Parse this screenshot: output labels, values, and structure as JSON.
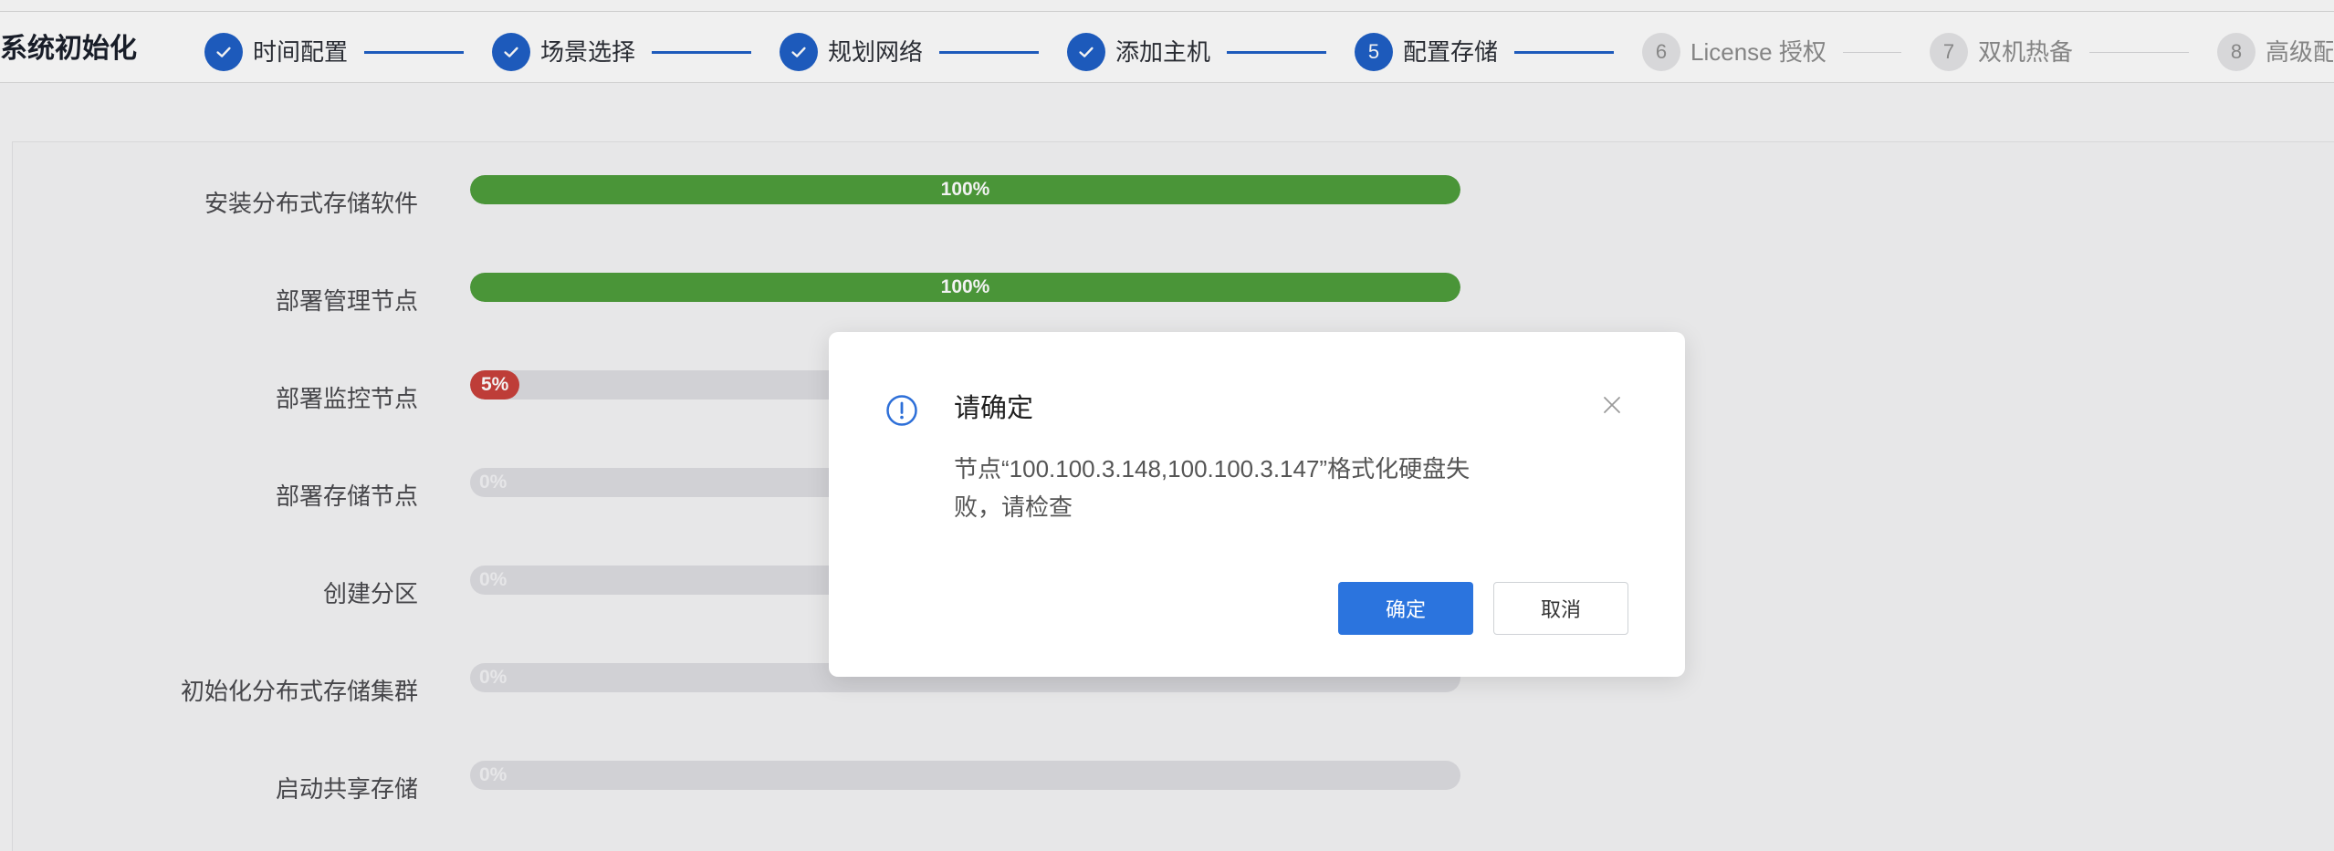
{
  "colors": {
    "primary": "#1f5fc6",
    "success": "#4f9d3c",
    "danger": "#c9413b",
    "track": "#dddde1",
    "pending_circle": "#e3e3e5"
  },
  "header": {
    "title": "系统初始化"
  },
  "steps": [
    {
      "label": "时间配置",
      "completed": true,
      "icon": "check-icon"
    },
    {
      "label": "场景选择",
      "completed": true,
      "icon": "check-icon"
    },
    {
      "label": "规划网络",
      "completed": true,
      "icon": "check-icon"
    },
    {
      "label": "添加主机",
      "completed": true,
      "icon": "check-icon"
    },
    {
      "number": "5",
      "label": "配置存储",
      "current": true
    },
    {
      "number": "6",
      "label": "License 授权"
    },
    {
      "number": "7",
      "label": "双机热备"
    },
    {
      "number": "8",
      "label": "高级配"
    }
  ],
  "progress": [
    {
      "label": "安装分布式存储软件",
      "percent": 100,
      "percent_label": "100%"
    },
    {
      "label": "部署管理节点",
      "percent": 100,
      "percent_label": "100%"
    },
    {
      "label": "部署监控节点",
      "percent": 5,
      "percent_label": "5%",
      "failed": true
    },
    {
      "label": "部署存储节点",
      "percent": 0,
      "percent_label": "0%"
    },
    {
      "label": "创建分区",
      "percent": 0,
      "percent_label": "0%"
    },
    {
      "label": "初始化分布式存储集群",
      "percent": 0,
      "percent_label": "0%"
    },
    {
      "label": "启动共享存储",
      "percent": 0,
      "percent_label": "0%"
    }
  ],
  "dialog": {
    "icon": "exclamation-circle-icon",
    "title": "请确定",
    "message_lines": [
      "节点“100.100.3.148,100.100.3.147”格式化硬盘失",
      "败，请检查"
    ],
    "confirm_label": "确定",
    "cancel_label": "取消",
    "close_icon": "close-icon"
  }
}
